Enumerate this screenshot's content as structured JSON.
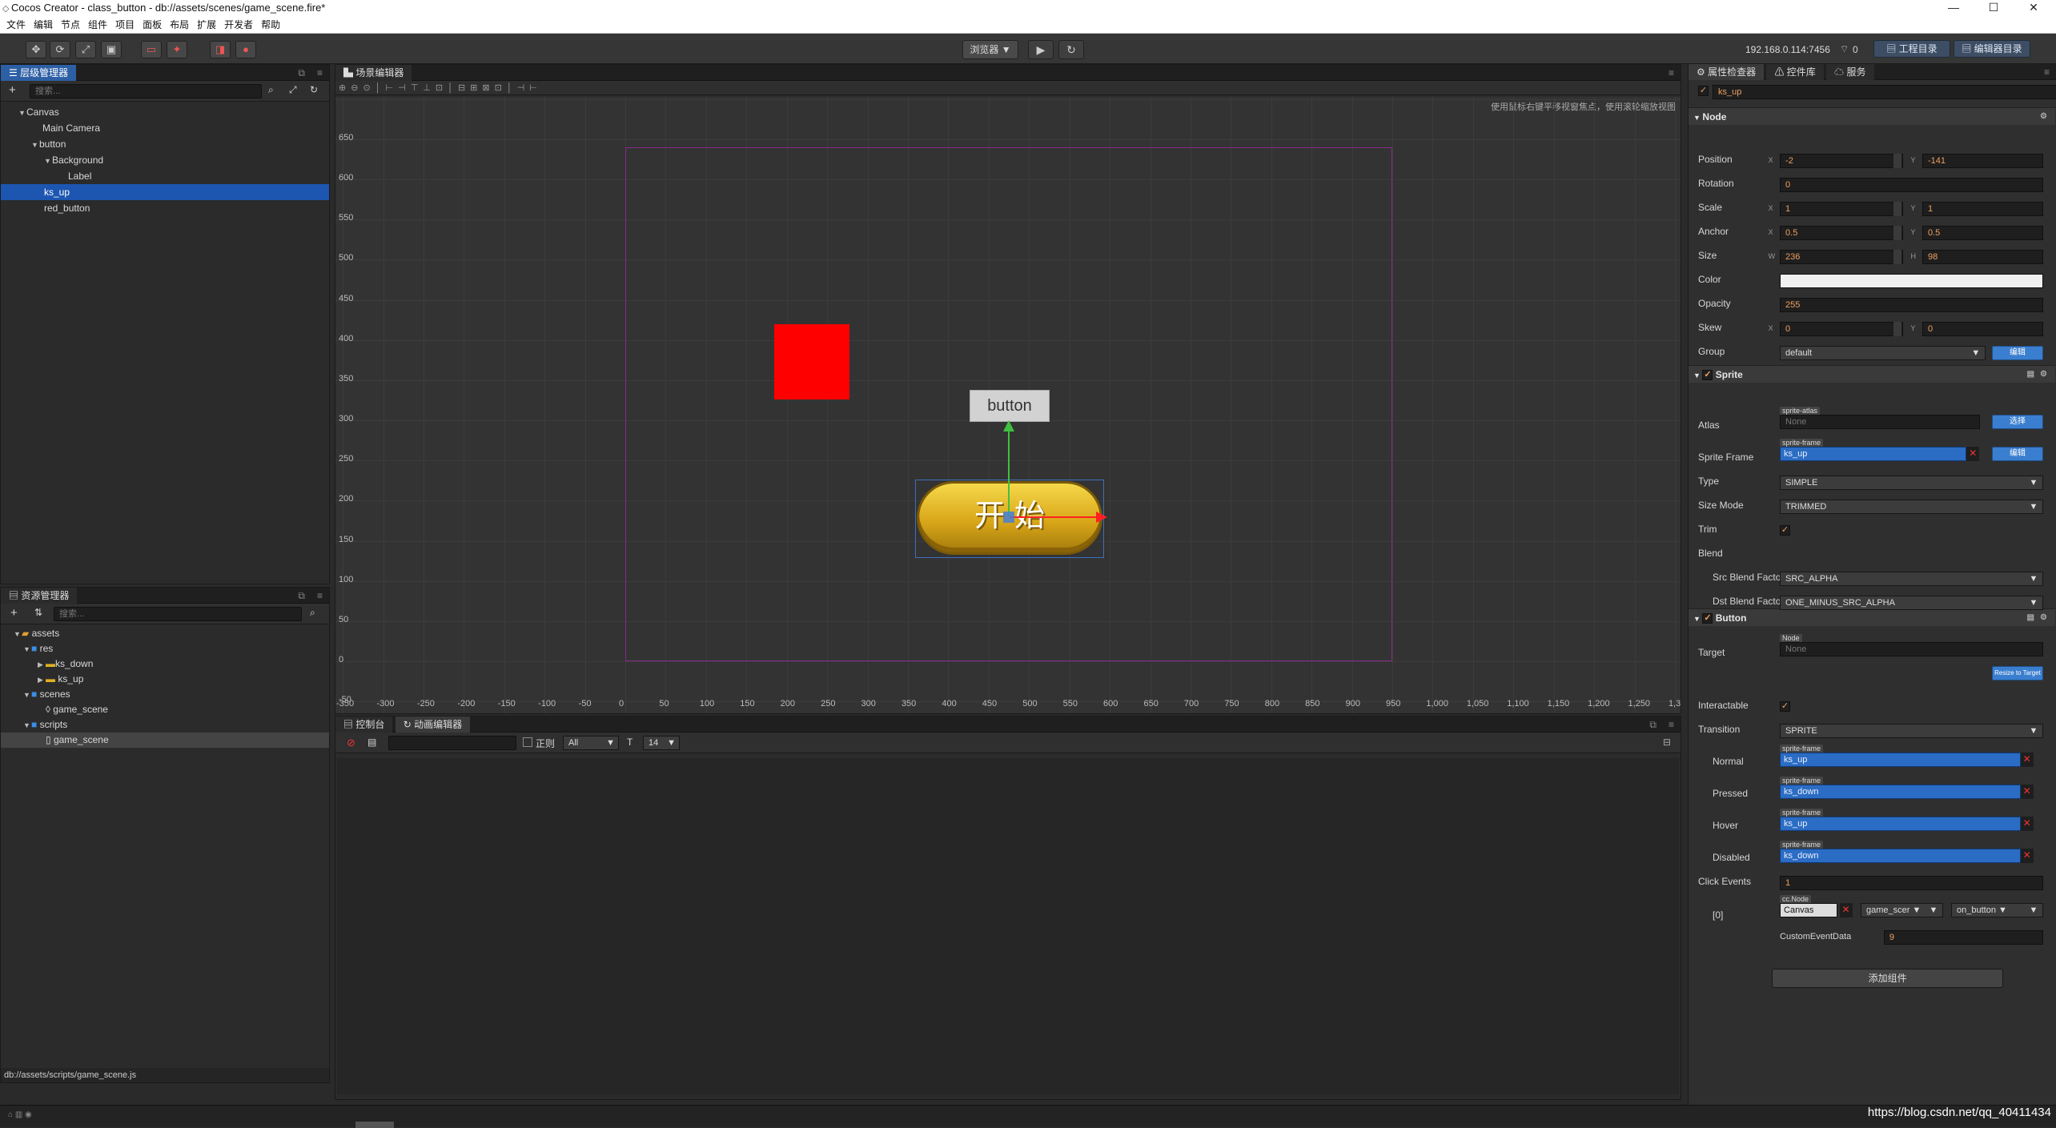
{
  "window": {
    "title": "Cocos Creator - class_button - db://assets/scenes/game_scene.fire*",
    "min": "—",
    "max": "☐",
    "close": "✕"
  },
  "menu": [
    "文件",
    "编辑",
    "节点",
    "组件",
    "项目",
    "面板",
    "布局",
    "扩展",
    "开发者",
    "帮助"
  ],
  "toolbar": {
    "preview": "浏览器 ▼",
    "play": "▶",
    "refresh": "↻",
    "ip": "192.168.0.114:7456",
    "wifi_count": "0",
    "project_dir": "工程目录",
    "editor_dir": "编辑器目录"
  },
  "hierarchy": {
    "tab": "层级管理器",
    "search": "搜索...",
    "items": [
      {
        "label": "Canvas",
        "indent": 0,
        "arrow": "▼"
      },
      {
        "label": "Main Camera",
        "indent": 1,
        "arrow": ""
      },
      {
        "label": "button",
        "indent": 1,
        "arrow": "▼"
      },
      {
        "label": "Background",
        "indent": 2,
        "arrow": "▼"
      },
      {
        "label": "Label",
        "indent": 3,
        "arrow": ""
      },
      {
        "label": "ks_up",
        "indent": 1,
        "arrow": ""
      },
      {
        "label": "red_button",
        "indent": 1,
        "arrow": ""
      }
    ]
  },
  "assets": {
    "tab": "资源管理器",
    "search": "搜索...",
    "items": [
      {
        "label": "assets",
        "indent": 0,
        "arrow": "▼"
      },
      {
        "label": "res",
        "indent": 1,
        "arrow": "▼"
      },
      {
        "label": "ks_down",
        "indent": 2,
        "arrow": "▶"
      },
      {
        "label": "ks_up",
        "indent": 2,
        "arrow": "▶"
      },
      {
        "label": "scenes",
        "indent": 1,
        "arrow": "▼"
      },
      {
        "label": "game_scene",
        "indent": 2,
        "arrow": ""
      },
      {
        "label": "scripts",
        "indent": 1,
        "arrow": "▼"
      },
      {
        "label": "game_scene",
        "indent": 2,
        "arrow": ""
      }
    ],
    "status": "db://assets/scripts/game_scene.js"
  },
  "scene": {
    "tab": "场景编辑器",
    "hint": "使用鼠标右键平移视窗焦点，使用滚轮缩放视图",
    "ylabels": [
      "650",
      "600",
      "550",
      "500",
      "450",
      "400",
      "350",
      "300",
      "250",
      "200",
      "150",
      "100",
      "50",
      "0",
      "-50"
    ],
    "xlabels": [
      "-350",
      "-300",
      "-250",
      "-200",
      "-150",
      "-100",
      "-50",
      "0",
      "50",
      "100",
      "150",
      "200",
      "250",
      "300",
      "350",
      "400",
      "450",
      "500",
      "550",
      "600",
      "650",
      "700",
      "750",
      "800",
      "850",
      "900",
      "950",
      "1,000",
      "1,050",
      "1,100",
      "1,150",
      "1,200",
      "1,250",
      "1,3"
    ],
    "button_label": "button",
    "start_label": "开 始"
  },
  "console": {
    "tab1": "控制台",
    "tab2": "动画编辑器",
    "regex": "正则",
    "level": "All",
    "fontsize": "14"
  },
  "inspector": {
    "tab1": "属性检查器",
    "tab2": "控件库",
    "tab3": "服务",
    "node_name": "ks_up",
    "node": {
      "title": "Node",
      "position_label": "Position",
      "pos_x": "-2",
      "pos_y": "-141",
      "rotation_label": "Rotation",
      "rotation": "0",
      "scale_label": "Scale",
      "scale_x": "1",
      "scale_y": "1",
      "anchor_label": "Anchor",
      "anchor_x": "0.5",
      "anchor_y": "0.5",
      "size_label": "Size",
      "size_w": "236",
      "size_h": "98",
      "color_label": "Color",
      "opacity_label": "Opacity",
      "opacity": "255",
      "skew_label": "Skew",
      "skew_x": "0",
      "skew_y": "0",
      "group_label": "Group",
      "group": "default",
      "edit": "编辑",
      "X": "X",
      "Y": "Y",
      "W": "W",
      "H": "H"
    },
    "sprite": {
      "title": "Sprite",
      "atlas_label": "Atlas",
      "atlas_tag": "sprite-atlas",
      "atlas": "None",
      "choose": "选择",
      "frame_label": "Sprite Frame",
      "frame_tag": "sprite-frame",
      "frame": "ks_up",
      "edit": "编辑",
      "type_label": "Type",
      "type": "SIMPLE",
      "sizemode_label": "Size Mode",
      "sizemode": "TRIMMED",
      "trim_label": "Trim",
      "blend_label": "Blend",
      "src_label": "Src Blend Factor",
      "src": "SRC_ALPHA",
      "dst_label": "Dst Blend Factor",
      "dst": "ONE_MINUS_SRC_ALPHA"
    },
    "button": {
      "title": "Button",
      "target_label": "Target",
      "target_tag": "Node",
      "target": "None",
      "resize": "Resize to Target",
      "interactable_label": "Interactable",
      "transition_label": "Transition",
      "transition": "SPRITE",
      "normal_label": "Normal",
      "normal": "ks_up",
      "pressed_label": "Pressed",
      "pressed": "ks_down",
      "hover_label": "Hover",
      "hover": "ks_up",
      "disabled_label": "Disabled",
      "disabled": "ks_down",
      "tag": "sprite-frame",
      "events_label": "Click Events",
      "events_count": "1",
      "index_label": "[0]",
      "ev_tag": "cc.Node",
      "ev_target": "Canvas",
      "ev_comp": "game_scer ▼",
      "ev_handler": "on_button ▼",
      "custom_label": "CustomEventData",
      "custom": "9"
    },
    "add_component": "添加组件"
  },
  "watermark": "https://blog.csdn.net/qq_40411434"
}
